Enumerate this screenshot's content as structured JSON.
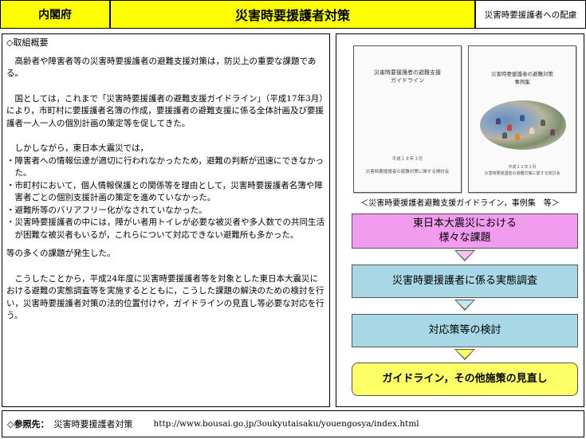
{
  "header": {
    "org": "内閣府",
    "title": "災害時要援護者対策",
    "subtitle": "災害時要援護者への配慮"
  },
  "overview": {
    "section_title": "◇取組概要",
    "p1": "高齢者や障害者等の災害時要援護者の避難支援対策は，防災上の重要な課題である。",
    "p2": "国としては，これまで「災害時要援護者の避難支援ガイドライン」（平成17年3月）により，市町村に要援護者名簿の作成，要援護者の避難支援に係る全体計画及び要援護者一人一人の個別計画の策定等を促してきた。",
    "p3_intro": "しかしながら，東日本大震災では，",
    "bullets": [
      "・障害者への情報伝達が適切に行われなかったため，避難の判断が迅速にできなかった。",
      "・市町村において，個人情報保護との関係等を理由として，災害時要援護者名簿や障害者ごとの個別支援計画の策定を進めていなかった。",
      "・避難所等のバリアフリー化がなされていなかった。",
      "・災害時要援護者の中には，障がい者用トイレが必要な被災者や多人数での共同生活が困難な被災者もいるが，これらについて対応できない避難所も多かった。"
    ],
    "p4": "等の多くの課題が発生した。",
    "p5": "こうしたことから，平成24年度に災害時要援護者等を対象とした東日本大震災における避難の実態調査等を実施するとともに，こうした課題の解決のための検討を行い，災害時要援護者対策の法的位置付けや，ガイドラインの見直し等必要な対応を行う。"
  },
  "docs": {
    "guideline_title_1": "災害時要援護者の避難支援",
    "guideline_title_2": "ガイドライン",
    "guideline_date": "平成１８年３月",
    "guideline_org": "災害時要援護者の避難対策に関する検討会",
    "casebook_title_1": "災害時要援護者の避難対策",
    "casebook_title_2": "事例集",
    "casebook_date": "平成２２年３月",
    "casebook_org": "災害時要援護者の避難対策に関する検討会",
    "caption": "＜災害時要援護者避難支援ガイドライン，事例集　等＞"
  },
  "flow": {
    "step1_line1": "東日本大震災における",
    "step1_line2": "様々な課題",
    "step2": "災害時要援護者に係る実態調査",
    "step3": "対応策等の検討",
    "step4": "ガイドライン，その他施策の見直し",
    "colors": {
      "step1": "#f29cef",
      "step2": "#a8d8e6",
      "step3": "#a8d8e6",
      "step4": "#ffff66"
    }
  },
  "reference": {
    "label": "◇参照先：",
    "name": "災害時要援護者対策",
    "url": "http://www.bousai.go.jp/3oukyutaisaku/youengosya/index.html"
  }
}
